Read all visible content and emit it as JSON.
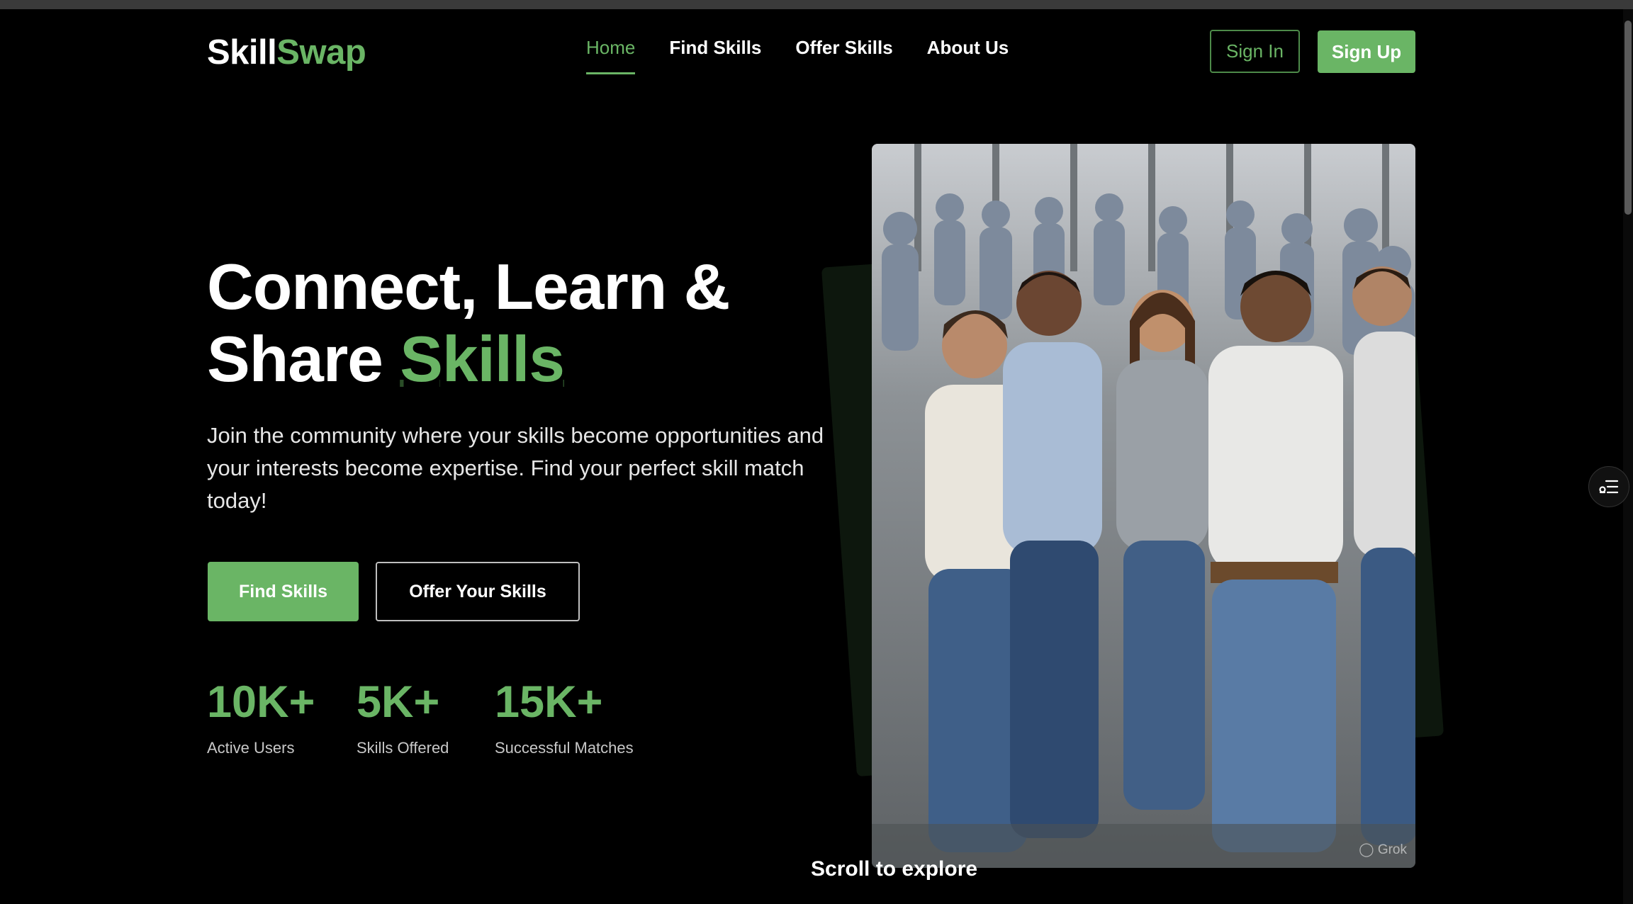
{
  "brand": {
    "part1": "Skill",
    "part2": "Swap"
  },
  "nav": [
    {
      "label": "Home",
      "active": true
    },
    {
      "label": "Find Skills"
    },
    {
      "label": "Offer Skills"
    },
    {
      "label": "About Us"
    }
  ],
  "auth": {
    "signin": "Sign In",
    "signup": "Sign Up"
  },
  "hero": {
    "title_line1": "Connect, Learn &",
    "title_line2_prefix": "Share ",
    "title_accent": "Skills",
    "subtitle": "Join the community where your skills become opportunities and your interests become expertise. Find your perfect skill match today!",
    "primary_cta": "Find Skills",
    "secondary_cta": "Offer Your Skills"
  },
  "stats": [
    {
      "value": "10K+",
      "label": "Active Users"
    },
    {
      "value": "5K+",
      "label": "Skills Offered"
    },
    {
      "value": "15K+",
      "label": "Successful Matches"
    }
  ],
  "image": {
    "watermark": "Grok"
  },
  "scroll_hint": "Scroll to explore",
  "colors": {
    "accent": "#6ab565",
    "background": "#000000"
  }
}
